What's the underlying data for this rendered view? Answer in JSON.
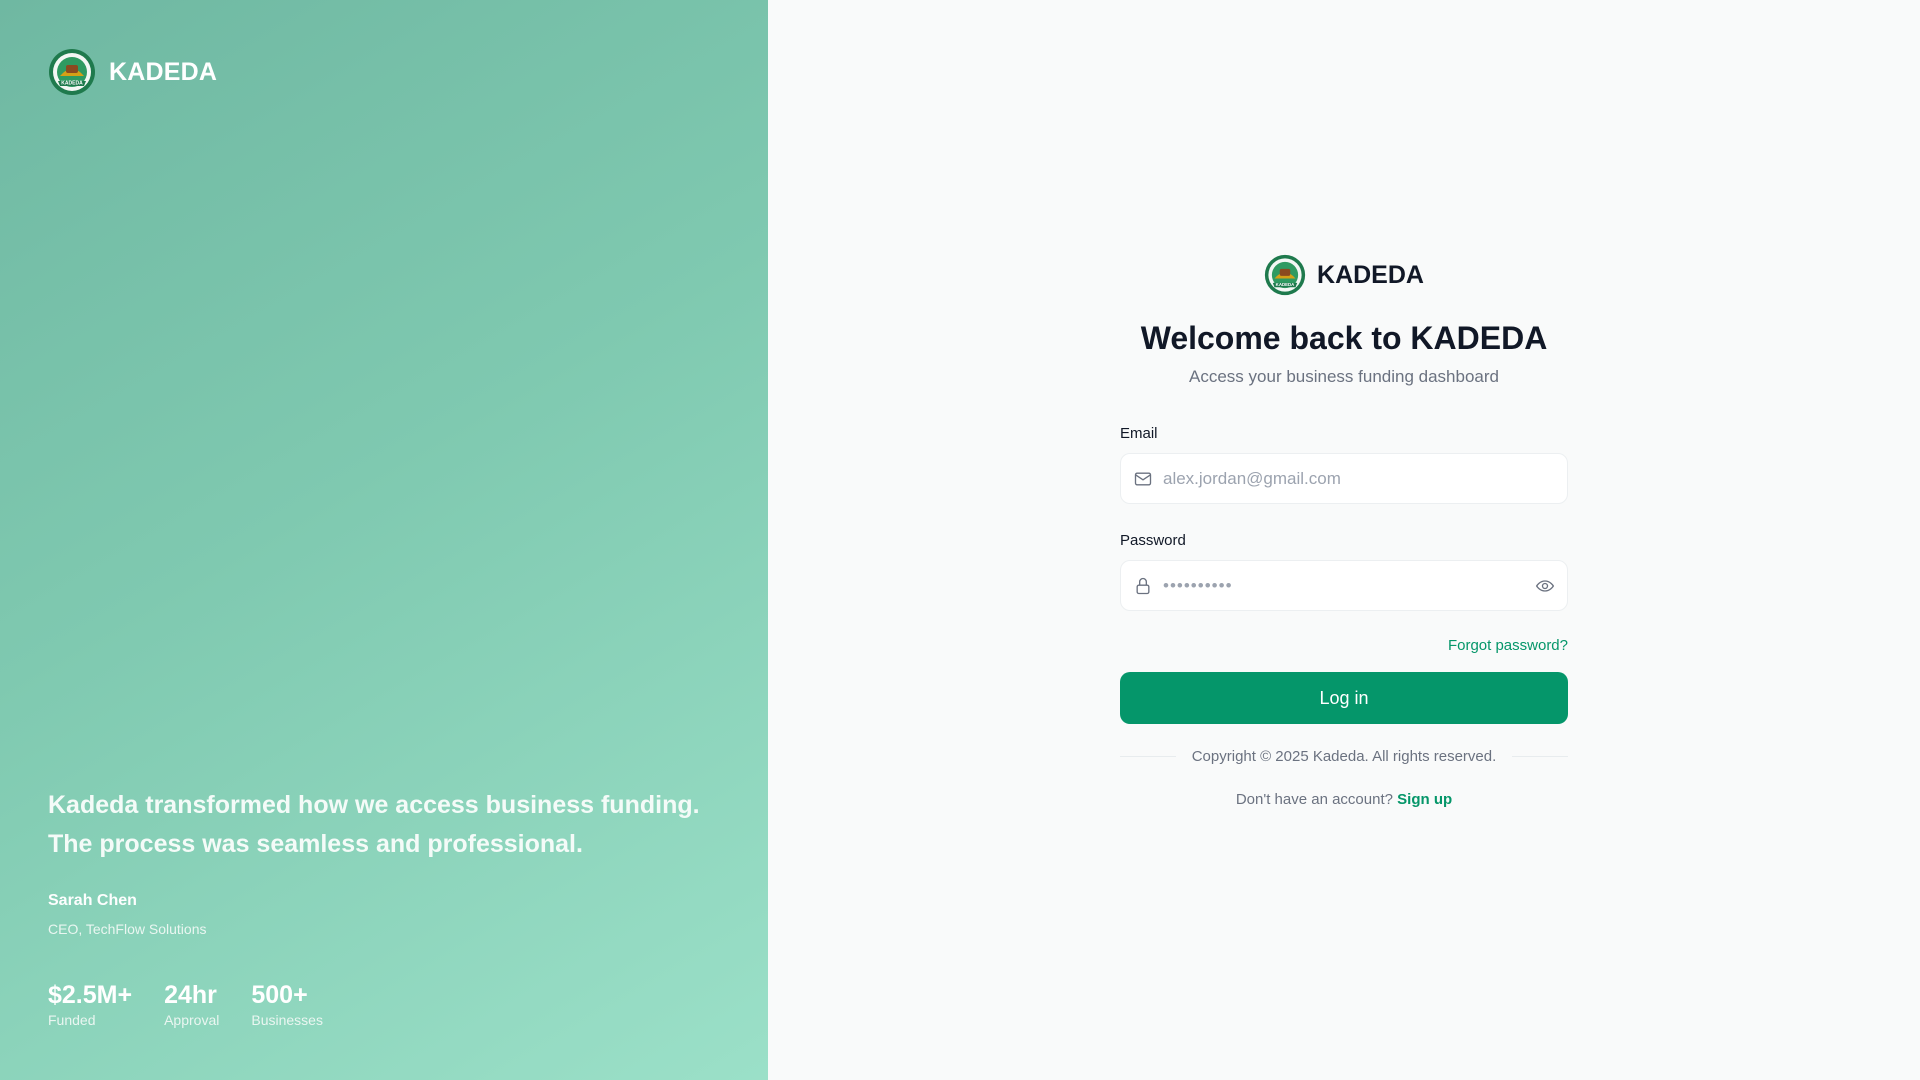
{
  "brand": {
    "name": "KADEDA",
    "logo_text": "KADEDA"
  },
  "testimonial": {
    "quote": "Kadeda transformed how we access business funding. The process was seamless and professional.",
    "author": "Sarah Chen",
    "author_title": "CEO, TechFlow Solutions"
  },
  "stats": [
    {
      "value": "$2.5M+",
      "label": "Funded"
    },
    {
      "value": "24hr",
      "label": "Approval"
    },
    {
      "value": "500+",
      "label": "Businesses"
    }
  ],
  "form": {
    "title": "Welcome back to KADEDA",
    "subtitle": "Access your business funding dashboard",
    "email_label": "Email",
    "email_placeholder": "alex.jordan@gmail.com",
    "password_label": "Password",
    "password_mask": "••••••••••",
    "forgot_label": "Forgot password?",
    "login_label": "Log in",
    "copyright": "Copyright © 2025 Kadeda. All rights reserved.",
    "signup_prompt": "Don't have an account?",
    "signup_label": "Sign up"
  },
  "icons": {
    "mail": "mail-icon",
    "lock": "lock-icon",
    "eye": "eye-icon",
    "logo": "kadeda-logo-icon"
  },
  "colors": {
    "accent": "#059669",
    "panel_start": "#6fb8a2",
    "panel_end": "#9be0c8",
    "text_dark": "#111827",
    "text_muted": "#6b7280"
  }
}
